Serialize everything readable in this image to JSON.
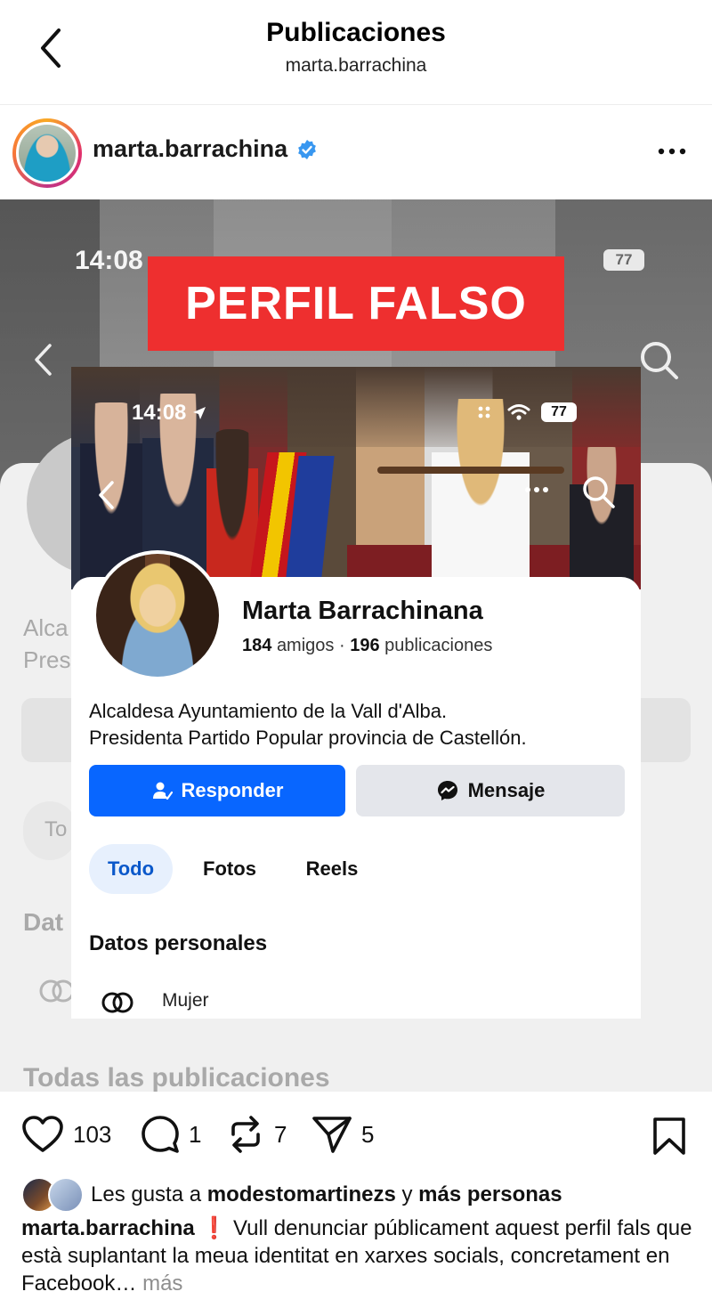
{
  "header": {
    "title": "Publicaciones",
    "subtitle": "marta.barrachina"
  },
  "post": {
    "username": "marta.barrachina",
    "verified": true,
    "banner_text": "PERFIL FALSO",
    "background_screen": {
      "time": "14:08",
      "battery": "77",
      "fragments": {
        "bio_line1": "Alca",
        "bio_line2": "Pres",
        "tab": "To",
        "section": "Dat",
        "all_posts": "Todas las publicaciones"
      }
    },
    "facebook": {
      "time": "14:08",
      "battery": "77",
      "name": "Marta Barrachinana",
      "friends_count": "184",
      "friends_label": "amigos",
      "separator": "·",
      "posts_count": "196",
      "posts_label": "publicaciones",
      "bio_line1": "Alcaldesa Ayuntamiento de la Vall d'Alba.",
      "bio_line2": "Presidenta Partido Popular provincia de Castellón.",
      "reply_button": "Responder",
      "message_button": "Mensaje",
      "tabs": [
        "Todo",
        "Fotos",
        "Reels"
      ],
      "active_tab": "Todo",
      "section_title": "Datos personales",
      "gender": "Mujer",
      "colors": {
        "primary": "#0866ff",
        "secondary_button": "#e4e6eb",
        "active_tab_bg": "#e7f0fd"
      }
    }
  },
  "actions": {
    "likes": "103",
    "comments": "1",
    "reposts": "7",
    "shares": "5"
  },
  "likes_line": {
    "prefix": "Les gusta a",
    "user": "modestomartinezs",
    "joiner": "y",
    "others": "más personas"
  },
  "caption": {
    "username": "marta.barrachina",
    "emoji": "❗",
    "text": "Vull denunciar públicament aquest perfil fals que està suplantant la meua identitat en xarxes socials, concretament en Facebook…",
    "more": "más"
  },
  "colors": {
    "banner": "#ee2f2f",
    "verified": "#3897f0",
    "muted": "#8e8e8e"
  },
  "icons": [
    "back-arrow-icon",
    "verified-badge-icon",
    "more-dots-icon",
    "heart-icon",
    "comment-icon",
    "repost-icon",
    "share-icon",
    "bookmark-icon",
    "search-icon",
    "wifi-icon",
    "location-arrow-icon",
    "messenger-icon",
    "add-friend-icon",
    "rings-icon"
  ]
}
